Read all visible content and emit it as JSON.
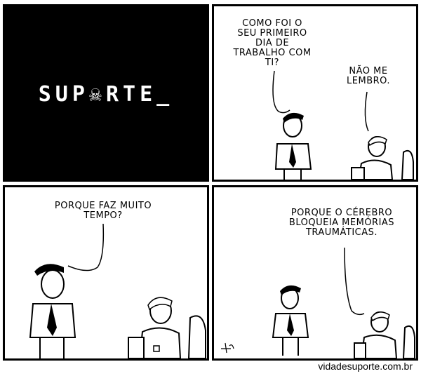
{
  "panel1": {
    "logo": "SUP☠RTE_"
  },
  "panel2": {
    "boss_lines": [
      "COMO FOI O",
      "SEU PRIMEIRO",
      "DIA DE",
      "TRABALHO COM",
      "TI?"
    ],
    "employee_lines": [
      "NÃO ME",
      "LEMBRO."
    ]
  },
  "panel3": {
    "boss_lines": [
      "PORQUE FAZ MUITO",
      "TEMPO?"
    ]
  },
  "panel4": {
    "employee_lines": [
      "PORQUE O CÉREBRO",
      "BLOQUEIA MEMÓRIAS",
      "TRAUMÁTICAS."
    ]
  },
  "credit": "vidadesuporte.com.br"
}
